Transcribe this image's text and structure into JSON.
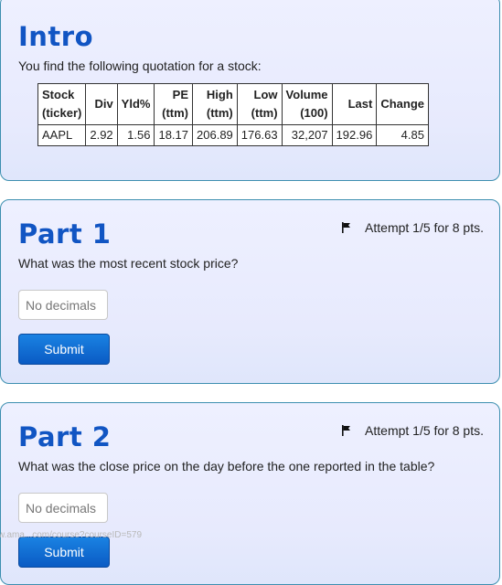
{
  "intro": {
    "heading": "Intro",
    "prompt": "You find the following quotation for a stock:",
    "table": {
      "headers": {
        "stock": [
          "Stock",
          "(ticker)"
        ],
        "div": "Div",
        "yld": "Yld%",
        "pe": [
          "PE",
          "(ttm)"
        ],
        "high": [
          "High",
          "(ttm)"
        ],
        "low": [
          "Low",
          "(ttm)"
        ],
        "volume": [
          "Volume",
          "(100)"
        ],
        "last": "Last",
        "change": "Change"
      },
      "row": {
        "ticker": "AAPL",
        "div": "2.92",
        "yld": "1.56",
        "pe": "18.17",
        "high": "206.89",
        "low": "176.63",
        "volume": "32,207",
        "last": "192.96",
        "change": "4.85"
      }
    }
  },
  "part1": {
    "heading": "Part 1",
    "attempt": "Attempt 1/5 for 8 pts.",
    "prompt": "What was the most recent stock price?",
    "input_placeholder": "No decimals",
    "submit_label": "Submit"
  },
  "part2": {
    "heading": "Part 2",
    "attempt": "Attempt 1/5 for 8 pts.",
    "prompt": "What was the close price on the day before the one reported in the table?",
    "input_placeholder": "No decimals",
    "submit_label": "Submit"
  },
  "status_url": "w.ama...com/course?courseID=579",
  "colors": {
    "heading": "#1155c3",
    "button": "#0a5bc4",
    "border": "#3d8fb0"
  },
  "icons": {
    "attempt": "flag-icon"
  }
}
